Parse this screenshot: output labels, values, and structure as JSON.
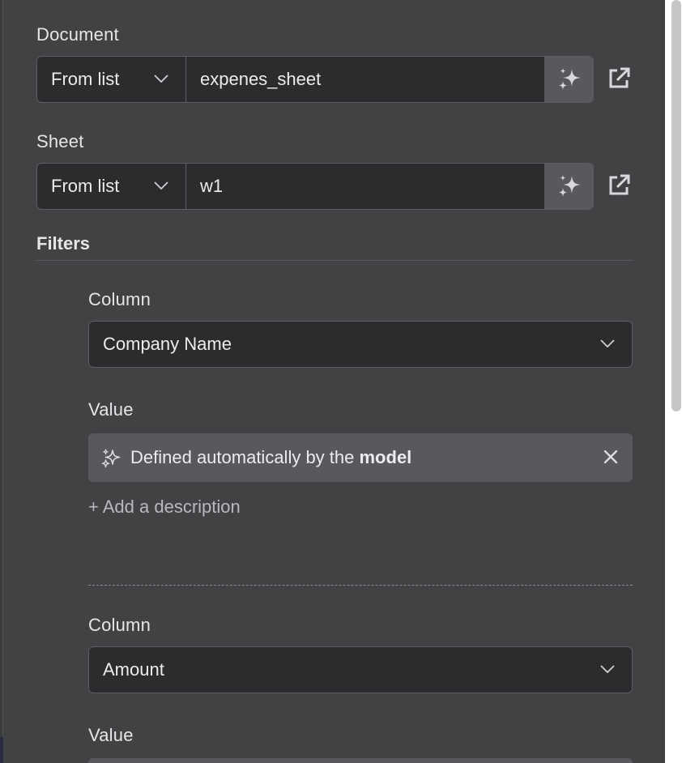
{
  "document": {
    "label": "Document",
    "mode": "From list",
    "value": "expenes_sheet"
  },
  "sheet": {
    "label": "Sheet",
    "mode": "From list",
    "value": "w1"
  },
  "filters": {
    "heading": "Filters",
    "items": [
      {
        "column_label": "Column",
        "column_value": "Company Name",
        "value_label": "Value",
        "value_prefix": "Defined automatically by the",
        "value_emphasis": "model",
        "add_description": "+ Add a description"
      },
      {
        "column_label": "Column",
        "column_value": "Amount",
        "value_label": "Value"
      }
    ]
  },
  "icons": {
    "ai": "sparkles-icon",
    "external": "external-link-icon",
    "dropdown": "chevron-down-icon",
    "clear": "close-icon"
  },
  "colors": {
    "panel_bg": "#414244",
    "input_bg": "#2c2c2e",
    "ai_button_bg": "#58595c",
    "text": "#e6e6e8"
  }
}
